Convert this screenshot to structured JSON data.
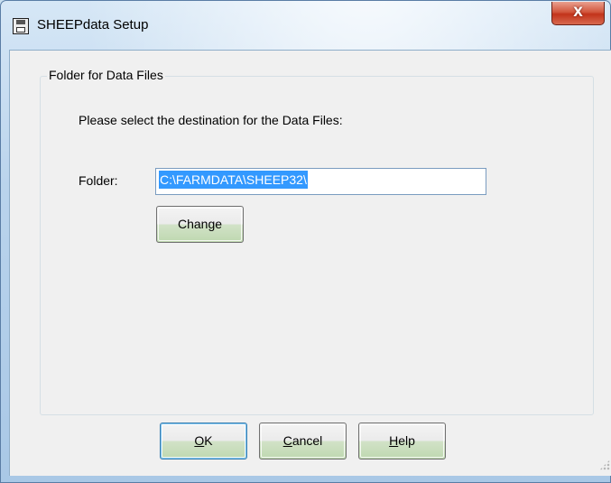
{
  "window": {
    "title": "SHEEPdata Setup",
    "close_label": "X",
    "title_icon": "floppy-disk-icon"
  },
  "group": {
    "title": "Folder for Data Files",
    "instruction": "Please select the destination for the Data Files:"
  },
  "folder": {
    "label": "Folder:",
    "value": "C:\\FARMDATA\\SHEEP32\\"
  },
  "buttons": {
    "change_pre": "Chan",
    "change_ul": "g",
    "change_post": "e",
    "ok_ul": "O",
    "ok_post": "K",
    "cancel_ul": "C",
    "cancel_post": "ancel",
    "help_ul": "H",
    "help_post": "elp"
  },
  "colors": {
    "selection": "#3399ff",
    "close_button": "#c2331a"
  }
}
